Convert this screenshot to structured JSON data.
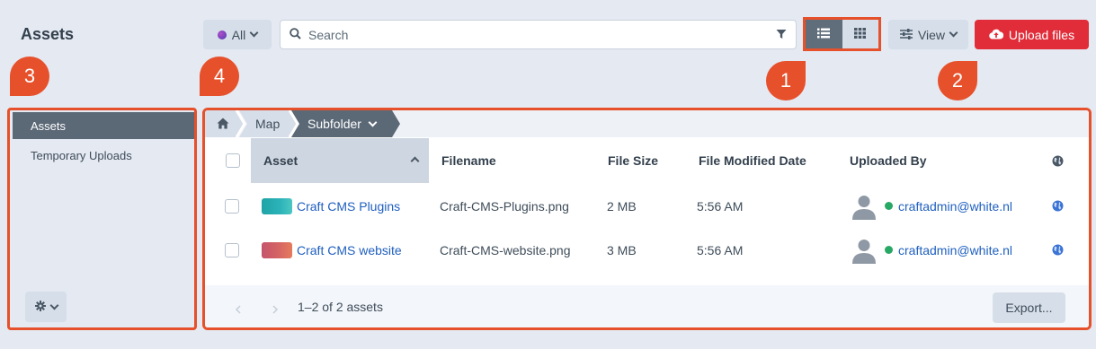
{
  "header": {
    "title": "Assets",
    "scope_label": "All",
    "search_placeholder": "Search",
    "view_label": "View",
    "upload_label": "Upload files",
    "active_view_mode": "list"
  },
  "markers": [
    "1",
    "2",
    "3",
    "4"
  ],
  "sidebar": {
    "items": [
      {
        "label": "Assets",
        "selected": true
      },
      {
        "label": "Temporary Uploads",
        "selected": false
      }
    ]
  },
  "breadcrumbs": [
    "Map",
    "Subfolder"
  ],
  "table": {
    "columns": [
      "Asset",
      "Filename",
      "File Size",
      "File Modified Date",
      "Uploaded By"
    ],
    "rows": [
      {
        "asset": "Craft CMS Plugins",
        "filename": "Craft-CMS-Plugins.png",
        "size": "2 MB",
        "modified": "5:56 AM",
        "uploaded_by": "craftadmin@white.nl"
      },
      {
        "asset": "Craft CMS website",
        "filename": "Craft-CMS-website.png",
        "size": "3 MB",
        "modified": "5:56 AM",
        "uploaded_by": "craftadmin@white.nl"
      }
    ]
  },
  "footer": {
    "count_text": "1–2 of 2 assets",
    "export_label": "Export..."
  },
  "colors": {
    "accent_marker": "#e6502b",
    "upload_button": "#e12d39",
    "link": "#1f5fbf",
    "online_status": "#27a864"
  }
}
